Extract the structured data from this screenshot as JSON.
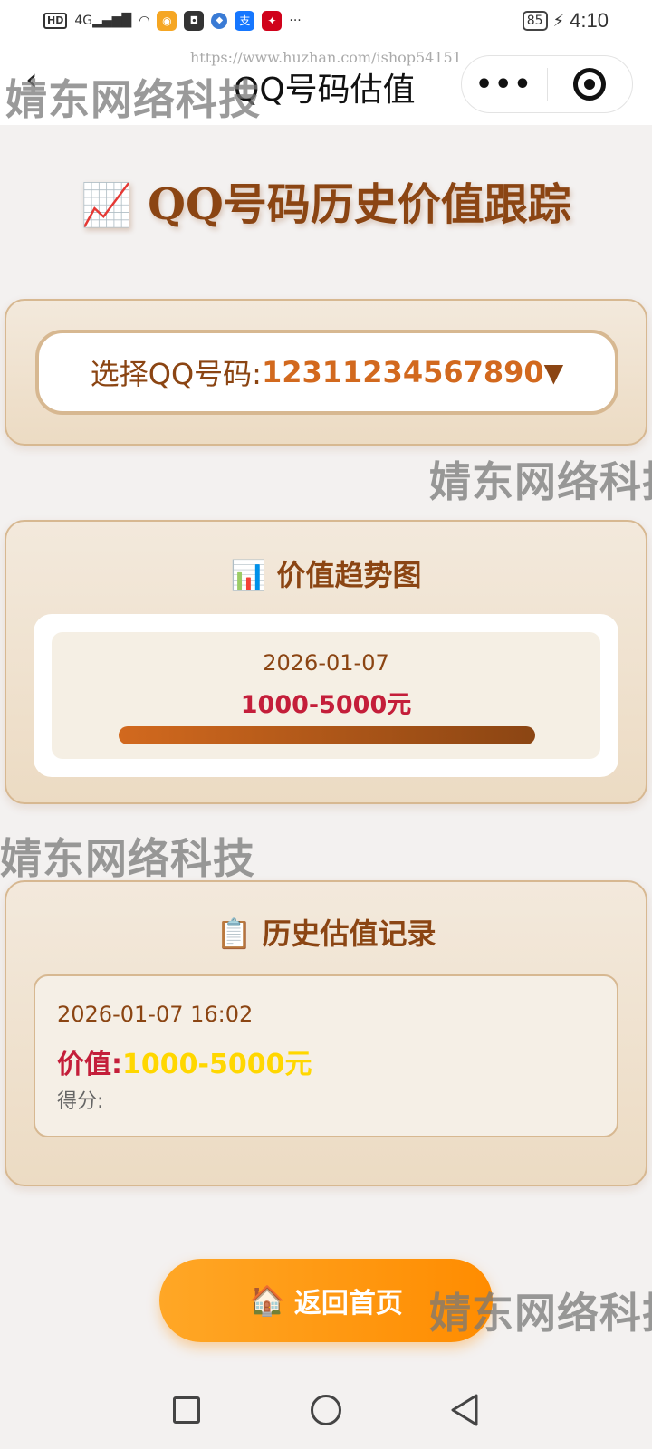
{
  "status_bar": {
    "hd": "HD",
    "signal": "4G",
    "more": "···",
    "battery": "85",
    "time": "4:10"
  },
  "nav": {
    "back_icon": "chevron-left-icon",
    "title": "QQ号码估值",
    "more_label": "•••"
  },
  "watermarks": {
    "url": "https://www.huzhan.com/ishop54151",
    "brand": "婧东网络科技"
  },
  "page": {
    "title_emoji": "📈",
    "title": "QQ号码历史价值跟踪"
  },
  "selector": {
    "label": "选择QQ号码:",
    "value": "12311234567890",
    "arrow": "▼"
  },
  "trend": {
    "emoji": "📊",
    "title": "价值趋势图"
  },
  "chart_data": {
    "type": "bar",
    "categories": [
      "2026-01-07"
    ],
    "values": [
      1
    ],
    "labels": [
      "1000-5000元"
    ],
    "title": "价值趋势图",
    "ylim": [
      0,
      1
    ]
  },
  "history": {
    "emoji": "📋",
    "title": "历史估值记录",
    "records": [
      {
        "time": "2026-01-07 16:02",
        "value_label": "价值:",
        "value": "1000-5000元",
        "score_label": "得分:"
      }
    ]
  },
  "home_button": {
    "emoji": "🏠",
    "label": "返回首页"
  },
  "colors": {
    "primary": "#8b4513",
    "accent": "#d2691e",
    "value_red": "#c41e3a",
    "gold": "#ffd700",
    "button_orange": "#ff8c00"
  }
}
